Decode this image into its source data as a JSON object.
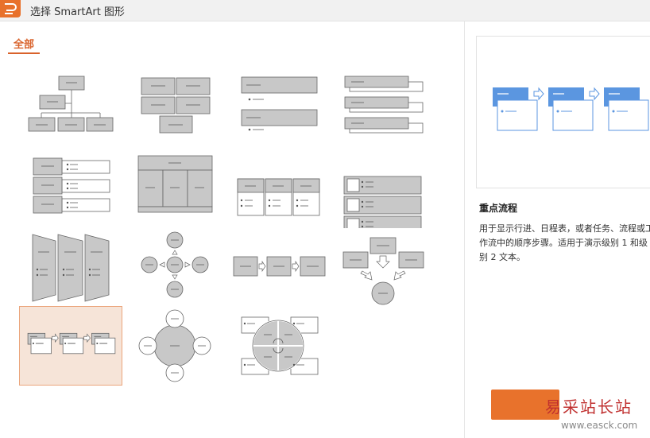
{
  "window": {
    "title": "选择 SmartArt 图形"
  },
  "tabs": [
    {
      "label": "全部"
    }
  ],
  "gallery": {
    "items": [
      {
        "name": "hierarchy"
      },
      {
        "name": "block-list"
      },
      {
        "name": "vertical-bullet-list"
      },
      {
        "name": "stacked-list"
      },
      {
        "name": "vertical-box-list"
      },
      {
        "name": "table-hierarchy"
      },
      {
        "name": "column-list"
      },
      {
        "name": "picture-list"
      },
      {
        "name": "segmented-process"
      },
      {
        "name": "radial-cycle"
      },
      {
        "name": "basic-process"
      },
      {
        "name": "converging-arrows"
      },
      {
        "name": "accent-process",
        "selected": true
      },
      {
        "name": "basic-radial"
      },
      {
        "name": "matrix-cycle"
      }
    ]
  },
  "preview": {
    "title": "重点流程",
    "description": "用于显示行进、日程表，或者任务、流程或工作流中的顺序步骤。适用于演示级别 1 和级别 2 文本。"
  },
  "watermark": {
    "text": "易采站长站",
    "url": "www.easck.com"
  },
  "colors": {
    "accent": "#e8722c",
    "shape_fill": "#c8c8c8",
    "preview_blue": "#5b96e0"
  }
}
